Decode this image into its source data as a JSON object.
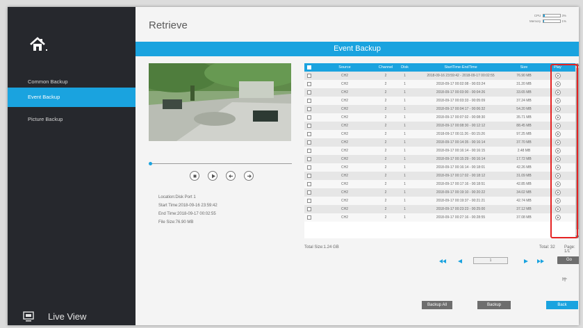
{
  "sidebar": {
    "items": [
      {
        "label": "Common Backup"
      },
      {
        "label": "Event Backup"
      },
      {
        "label": "Picture Backup"
      }
    ],
    "live_view": "Live View"
  },
  "header": {
    "title": "Retrieve",
    "cpu_label": "CPU",
    "cpu_value": "3%",
    "memory_label": "Memory",
    "memory_value": "1%"
  },
  "banner": "Event Backup",
  "info": {
    "location": "Location:Disk Port 1",
    "start": "Start Time:2018-09-16 23:59:42",
    "end": "End Time:2018-09-17 00:02:55",
    "size": "File Size:76.90 MB"
  },
  "table": {
    "columns": [
      "Source",
      "Channel",
      "Disk",
      "StartTime-EndTime",
      "Size",
      "Play"
    ],
    "rows": [
      {
        "source": "CH2",
        "channel": "2",
        "disk": "1",
        "time": "2018-09-16 23:59:42 - 2018-09-17 00:02:55",
        "size": "76.90 MB"
      },
      {
        "source": "CH2",
        "channel": "2",
        "disk": "1",
        "time": "2018-09-17 00:02:08 - 00:03:24",
        "size": "31.20 MB"
      },
      {
        "source": "CH2",
        "channel": "2",
        "disk": "1",
        "time": "2018-09-17 00:03:00 - 00:04:26",
        "size": "33.65 MB"
      },
      {
        "source": "CH2",
        "channel": "2",
        "disk": "1",
        "time": "2018-09-17 00:03:33 - 00:05:09",
        "size": "37.24 MB"
      },
      {
        "source": "CH2",
        "channel": "2",
        "disk": "1",
        "time": "2018-09-17 00:04:17 - 00:06:32",
        "size": "54.20 MB"
      },
      {
        "source": "CH2",
        "channel": "2",
        "disk": "1",
        "time": "2018-09-17 00:07:02 - 00:08:30",
        "size": "35.71 MB"
      },
      {
        "source": "CH2",
        "channel": "2",
        "disk": "1",
        "time": "2018-09-17 00:08:30 - 00:12:12",
        "size": "88.45 MB"
      },
      {
        "source": "CH2",
        "channel": "2",
        "disk": "1",
        "time": "2018-09-17 00:11:26 - 00:15:26",
        "size": "97.25 MB"
      },
      {
        "source": "CH2",
        "channel": "2",
        "disk": "1",
        "time": "2018-09-17 00:14:35 - 00:16:14",
        "size": "37.70 MB"
      },
      {
        "source": "CH2",
        "channel": "2",
        "disk": "1",
        "time": "2018-09-17 00:16:14 - 00:16:15",
        "size": "2.48 MB"
      },
      {
        "source": "CH2",
        "channel": "2",
        "disk": "1",
        "time": "2018-09-17 00:15:29 - 00:16:14",
        "size": "17.72 MB"
      },
      {
        "source": "CH2",
        "channel": "2",
        "disk": "1",
        "time": "2018-09-17 00:16:14 - 00:18:01",
        "size": "42.26 MB"
      },
      {
        "source": "CH2",
        "channel": "2",
        "disk": "1",
        "time": "2018-09-17 00:17:02 - 00:18:12",
        "size": "31.09 MB"
      },
      {
        "source": "CH2",
        "channel": "2",
        "disk": "1",
        "time": "2018-09-17 00:17:16 - 00:18:51",
        "size": "42.85 MB"
      },
      {
        "source": "CH2",
        "channel": "2",
        "disk": "1",
        "time": "2018-09-17 00:19:10 - 00:20:22",
        "size": "34.02 MB"
      },
      {
        "source": "CH2",
        "channel": "2",
        "disk": "1",
        "time": "2018-09-17 00:19:37 - 00:21:21",
        "size": "42.74 MB"
      },
      {
        "source": "CH2",
        "channel": "2",
        "disk": "1",
        "time": "2018-09-17 00:23:23 - 00:25:00",
        "size": "37.12 MB"
      },
      {
        "source": "CH2",
        "channel": "2",
        "disk": "1",
        "time": "2018-09-17 00:27:16 - 00:28:55",
        "size": "37.08 MB"
      }
    ]
  },
  "footer": {
    "total_size": "Total Size:1.24 GB",
    "total": "Total: 32",
    "page": "Page: 1/1",
    "page_input": "1",
    "go": "Go"
  },
  "buttons": {
    "backup_all": "Backup All",
    "backup": "Backup",
    "back": "Back"
  },
  "colors": {
    "accent": "#1aa3df",
    "sidebar_bg": "#26282d",
    "highlight": "#e52222"
  }
}
